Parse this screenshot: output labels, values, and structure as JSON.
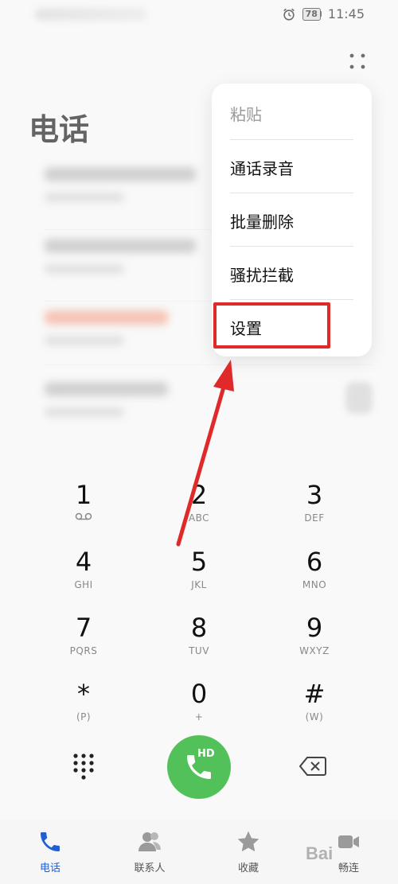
{
  "status_bar": {
    "time": "11:45",
    "battery": "78"
  },
  "page_title": "电话",
  "menu": {
    "items": [
      {
        "label": "粘贴",
        "disabled": true
      },
      {
        "label": "通话录音"
      },
      {
        "label": "批量删除"
      },
      {
        "label": "骚扰拦截"
      },
      {
        "label": "设置"
      }
    ]
  },
  "keypad": {
    "keys": [
      {
        "digit": "1",
        "letters": ""
      },
      {
        "digit": "2",
        "letters": "ABC"
      },
      {
        "digit": "3",
        "letters": "DEF"
      },
      {
        "digit": "4",
        "letters": "GHI"
      },
      {
        "digit": "5",
        "letters": "JKL"
      },
      {
        "digit": "6",
        "letters": "MNO"
      },
      {
        "digit": "7",
        "letters": "PQRS"
      },
      {
        "digit": "8",
        "letters": "TUV"
      },
      {
        "digit": "9",
        "letters": "WXYZ"
      },
      {
        "digit": "*",
        "letters": "(P)"
      },
      {
        "digit": "0",
        "letters": "+"
      },
      {
        "digit": "#",
        "letters": "(W)"
      }
    ]
  },
  "call_button": {
    "badge": "HD",
    "color": "#53c15a"
  },
  "tabs": [
    {
      "label": "电话",
      "icon": "phone-icon",
      "active": true
    },
    {
      "label": "联系人",
      "icon": "contacts-icon"
    },
    {
      "label": "收藏",
      "icon": "star-icon"
    },
    {
      "label": "畅连",
      "icon": "video-icon"
    }
  ],
  "watermark": "Bai",
  "colors": {
    "accent": "#1e5fd6",
    "highlight": "#e02a2a",
    "call": "#53c15a"
  }
}
